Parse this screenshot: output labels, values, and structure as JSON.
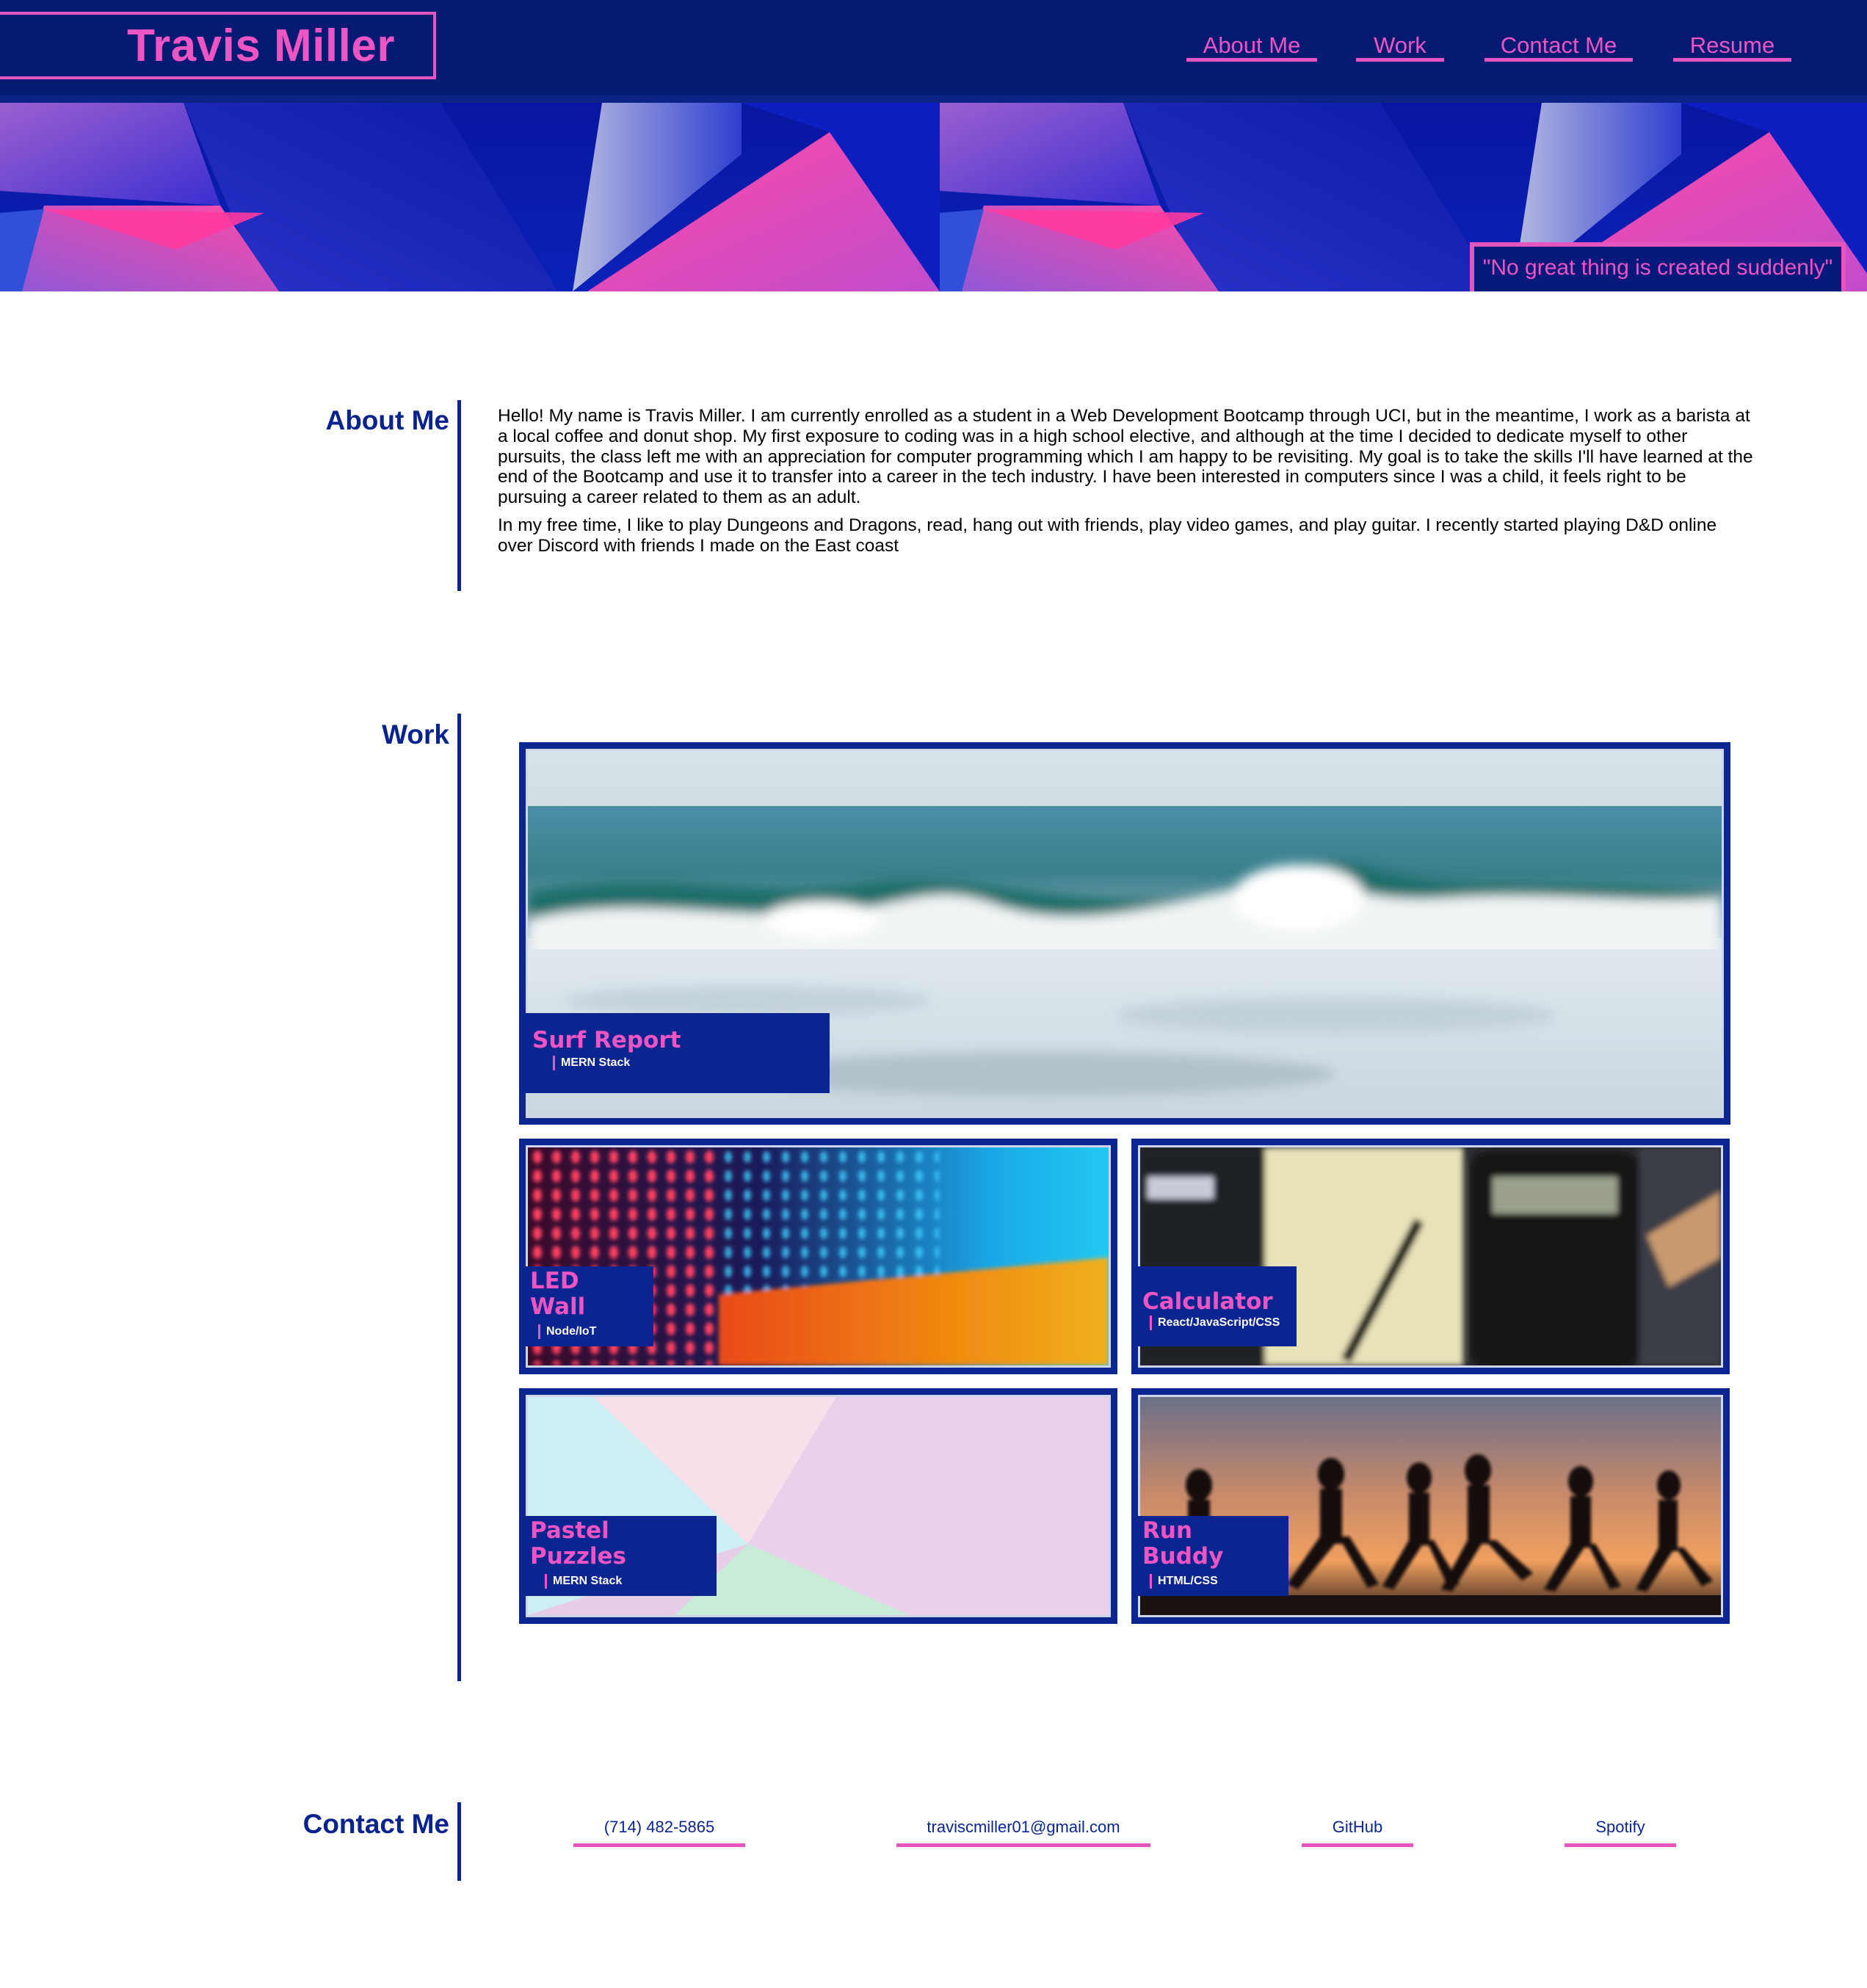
{
  "header": {
    "name": "Travis Miller",
    "nav": [
      "About Me",
      "Work",
      "Contact Me",
      "Resume"
    ]
  },
  "hero": {
    "quote": "\"No great thing is created suddenly\""
  },
  "about": {
    "title": "About Me",
    "paragraphs": [
      "Hello! My name is Travis Miller. I am currently enrolled as a student in a Web Development Bootcamp through UCI, but in the meantime, I work as a barista at a local coffee and donut shop. My first exposure to coding was in a high school elective, and although at the time I decided to dedicate myself to other pursuits, the class left me with an appreciation for computer programming which I am happy to be revisiting. My goal is to take the skills I'll have learned at the end of the Bootcamp and use it to transfer into a career in the tech industry. I have been interested in computers since I was a child, it feels right to be pursuing a career related to them as an adult.",
      "In my free time, I like to play Dungeons and Dragons, read, hang out with friends, play video games, and play guitar. I recently started playing D&D online over Discord with friends I made on the East coast"
    ]
  },
  "work": {
    "title": "Work",
    "projects": [
      {
        "title": "Surf Report",
        "tech": "MERN Stack"
      },
      {
        "title": "LED Wall",
        "tech": "Node/IoT"
      },
      {
        "title": "Calculator",
        "tech": "React/JavaScript/CSS"
      },
      {
        "title": "Pastel Puzzles",
        "tech": "MERN Stack"
      },
      {
        "title": "Run Buddy",
        "tech": "HTML/CSS"
      }
    ]
  },
  "contact": {
    "title": "Contact Me",
    "links": [
      "(714) 482-5865",
      "traviscmiller01@gmail.com",
      "GitHub",
      "Spotify"
    ]
  },
  "colors": {
    "navy": "#061a73",
    "accent_pink": "#ee55c4",
    "royal_blue": "#0b2690"
  }
}
